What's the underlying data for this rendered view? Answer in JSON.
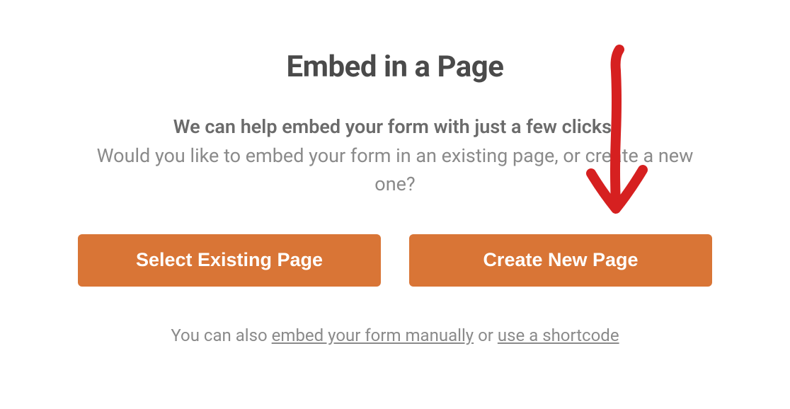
{
  "modal": {
    "title": "Embed in a Page",
    "subtitle_bold": "We can help embed your form with just a few clicks!",
    "subtitle_regular": "Would you like to embed your form in an existing page, or create a new one?",
    "buttons": {
      "select_existing": "Select Existing Page",
      "create_new": "Create New Page"
    },
    "footer": {
      "prefix": "You can also ",
      "link1": "embed your form manually",
      "middle": " or ",
      "link2": "use a shortcode"
    }
  },
  "annotation": {
    "arrow_color": "#d62020"
  }
}
